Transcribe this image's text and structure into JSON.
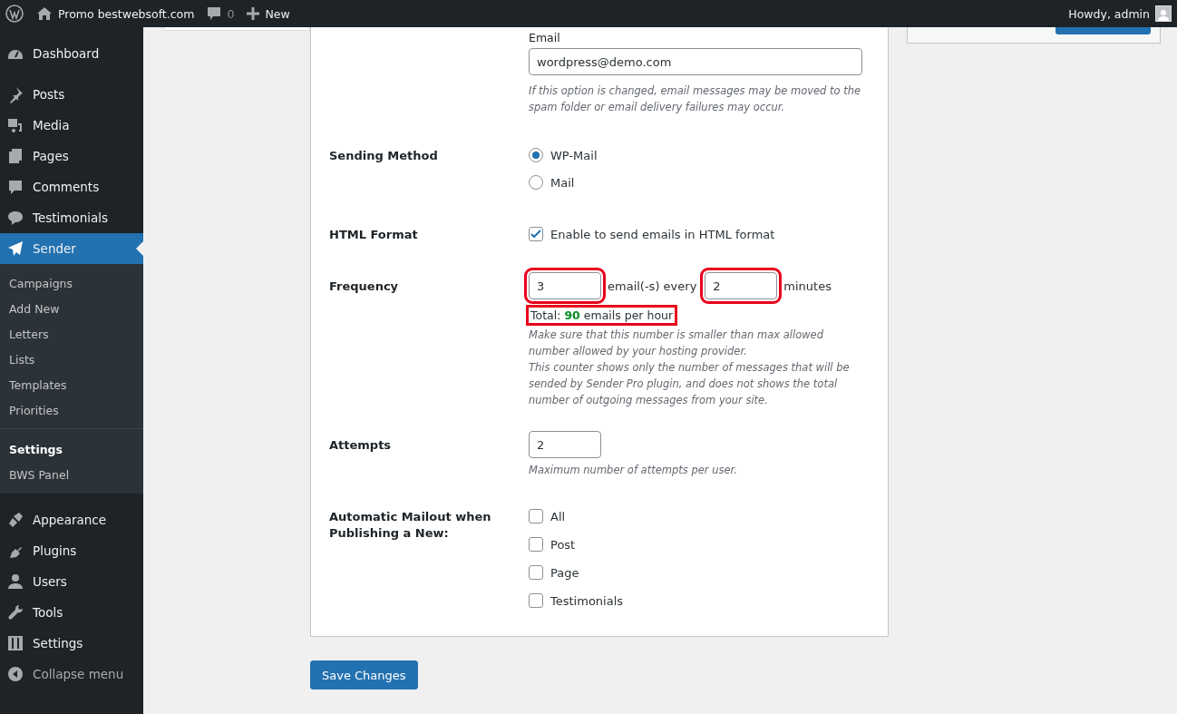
{
  "admin_bar": {
    "site_name": "Promo bestwebsoft.com",
    "comments_count": "0",
    "new_label": "New",
    "greeting": "Howdy, admin"
  },
  "sidebar": {
    "items": [
      {
        "label": "Dashboard",
        "selected": false
      },
      {
        "label": "Posts",
        "selected": false
      },
      {
        "label": "Media",
        "selected": false
      },
      {
        "label": "Pages",
        "selected": false
      },
      {
        "label": "Comments",
        "selected": false
      },
      {
        "label": "Testimonials",
        "selected": false
      },
      {
        "label": "Sender",
        "selected": true,
        "children": [
          {
            "label": "Campaigns",
            "selected": false
          },
          {
            "label": "Add New",
            "selected": false
          },
          {
            "label": "Letters",
            "selected": false
          },
          {
            "label": "Lists",
            "selected": false
          },
          {
            "label": "Templates",
            "selected": false
          },
          {
            "label": "Priorities",
            "selected": false
          },
          {
            "label": "Settings",
            "selected": true
          },
          {
            "label": "BWS Panel",
            "selected": false
          }
        ]
      },
      {
        "label": "Appearance",
        "selected": false
      },
      {
        "label": "Plugins",
        "selected": false
      },
      {
        "label": "Users",
        "selected": false
      },
      {
        "label": "Tools",
        "selected": false
      },
      {
        "label": "Settings",
        "selected": false
      },
      {
        "label": "Collapse menu",
        "selected": false
      }
    ]
  },
  "form": {
    "rows": [
      {
        "kind": "email",
        "label": "",
        "field_label": "Email",
        "value": "wordpress@demo.com",
        "hint": "If this option is changed, email messages may be moved to the spam folder or email delivery failures may occur."
      },
      {
        "kind": "radio",
        "label": "Sending Method",
        "options": [
          {
            "label": "WP-Mail",
            "selected": true
          },
          {
            "label": "Mail",
            "selected": false
          }
        ]
      },
      {
        "kind": "checkbox",
        "label": "HTML Format",
        "options": [
          {
            "label": "Enable to send emails in HTML format",
            "checked": true
          }
        ]
      },
      {
        "kind": "frequency",
        "label": "Frequency",
        "emails": {
          "value": "3",
          "highlighted": true
        },
        "between": "email(-s) every",
        "minutes": {
          "value": "2",
          "highlighted": true
        },
        "unit": "minutes",
        "total": {
          "text": "Total: **90** emails per hour",
          "highlighted": true
        },
        "hints": [
          "Make sure that this number is smaller than max allowed number allowed by your hosting provider.",
          "This counter shows only the number of messages that will be sended by Sender Pro plugin, and does not shows the total number of outgoing messages from your site."
        ]
      },
      {
        "kind": "number",
        "label": "Attempts",
        "value": "2",
        "hint": "Maximum number of attempts per user."
      },
      {
        "kind": "checkbox",
        "label": "Automatic Mailout when Publishing a New:",
        "options": [
          {
            "label": "All",
            "checked": false
          },
          {
            "label": "Post",
            "checked": false
          },
          {
            "label": "Page",
            "checked": false
          },
          {
            "label": "Testimonials",
            "checked": false
          }
        ]
      }
    ]
  },
  "save_button": "Save Changes"
}
